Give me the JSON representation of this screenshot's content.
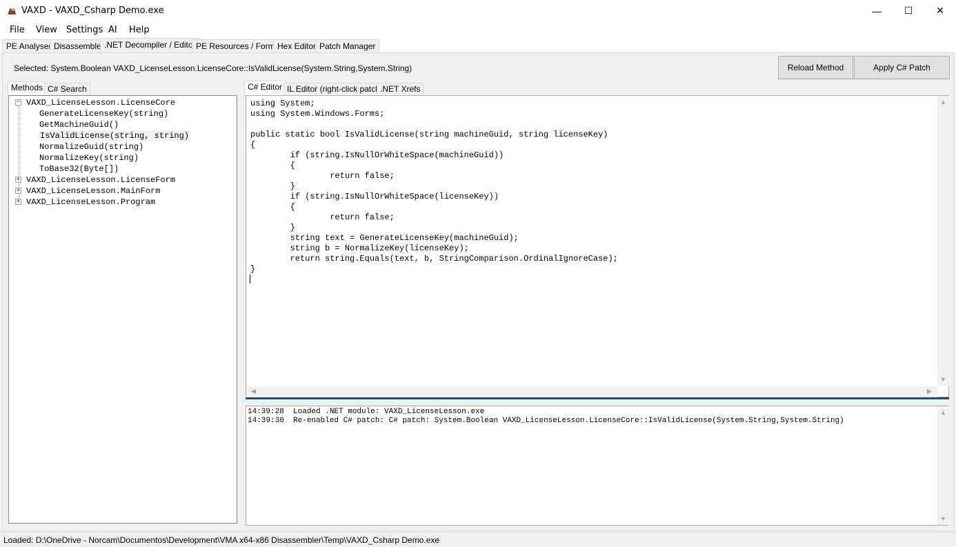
{
  "window": {
    "title": "VAXD - VAXD_Csharp Demo.exe",
    "minimize_glyph": "—",
    "maximize_glyph": "☐",
    "close_glyph": "✕"
  },
  "menu": [
    "File",
    "View",
    "Settings",
    "AI",
    "Help"
  ],
  "main_tabs": [
    "PE Analyser",
    "Disassembler",
    ".NET Decompiler / Editor",
    "PE Resources / Forms",
    "Hex Editor",
    "Patch Manager"
  ],
  "selected_label": "Selected: System.Boolean VAXD_LicenseLesson.LicenseCore::IsValidLicense(System.String,System.String)",
  "buttons": {
    "reload": "Reload Method",
    "apply": "Apply C# Patch"
  },
  "left_tabs": [
    "Methods",
    "C# Search"
  ],
  "tree": {
    "root": "VAXD_LicenseLesson.LicenseCore",
    "children": [
      "GenerateLicenseKey(string)",
      "GetMachineGuid()",
      "IsValidLicense(string, string)",
      "NormalizeGuid(string)",
      "NormalizeKey(string)",
      "ToBase32(Byte[])"
    ],
    "others": [
      "VAXD_LicenseLesson.LicenseForm",
      "VAXD_LicenseLesson.MainForm",
      "VAXD_LicenseLesson.Program"
    ],
    "expanded_glyph": "−",
    "collapsed_glyph": "+"
  },
  "editor_tabs": [
    "C# Editor",
    "IL Editor (right-click patch)",
    ".NET Xrefs"
  ],
  "code_lines": [
    "using System;",
    "using System.Windows.Forms;",
    "",
    "public static bool IsValidLicense(string machineGuid, string licenseKey)",
    "{",
    "        if (string.IsNullOrWhiteSpace(machineGuid))",
    "        {",
    "                return false;",
    "        }",
    "        if (string.IsNullOrWhiteSpace(licenseKey))",
    "        {",
    "                return false;",
    "        }",
    "        string text = GenerateLicenseKey(machineGuid);",
    "        string b = NormalizeKey(licenseKey);",
    "        return string.Equals(text, b, StringComparison.OrdinalIgnoreCase);",
    "}"
  ],
  "log_lines": [
    "14:39:28  Loaded .NET module: VAXD_LicenseLesson.exe",
    "14:39:30  Re-enabled C# patch: C# patch: System.Boolean VAXD_LicenseLesson.LicenseCore::IsValidLicense(System.String,System.String)"
  ],
  "status": "Loaded: D:\\OneDrive - Norcam\\Documentos\\Development\\VMA x64-x86 Disassembler\\Temp\\VAXD_Csharp Demo.exe",
  "arrows": {
    "up": "▲",
    "down": "▼",
    "left": "◀",
    "right": "▶"
  },
  "icons": {
    "app": "app-icon",
    "expand": "expander-icon"
  },
  "colors": {
    "splitter": "#1a5276",
    "selection": "#f0f0f0"
  }
}
